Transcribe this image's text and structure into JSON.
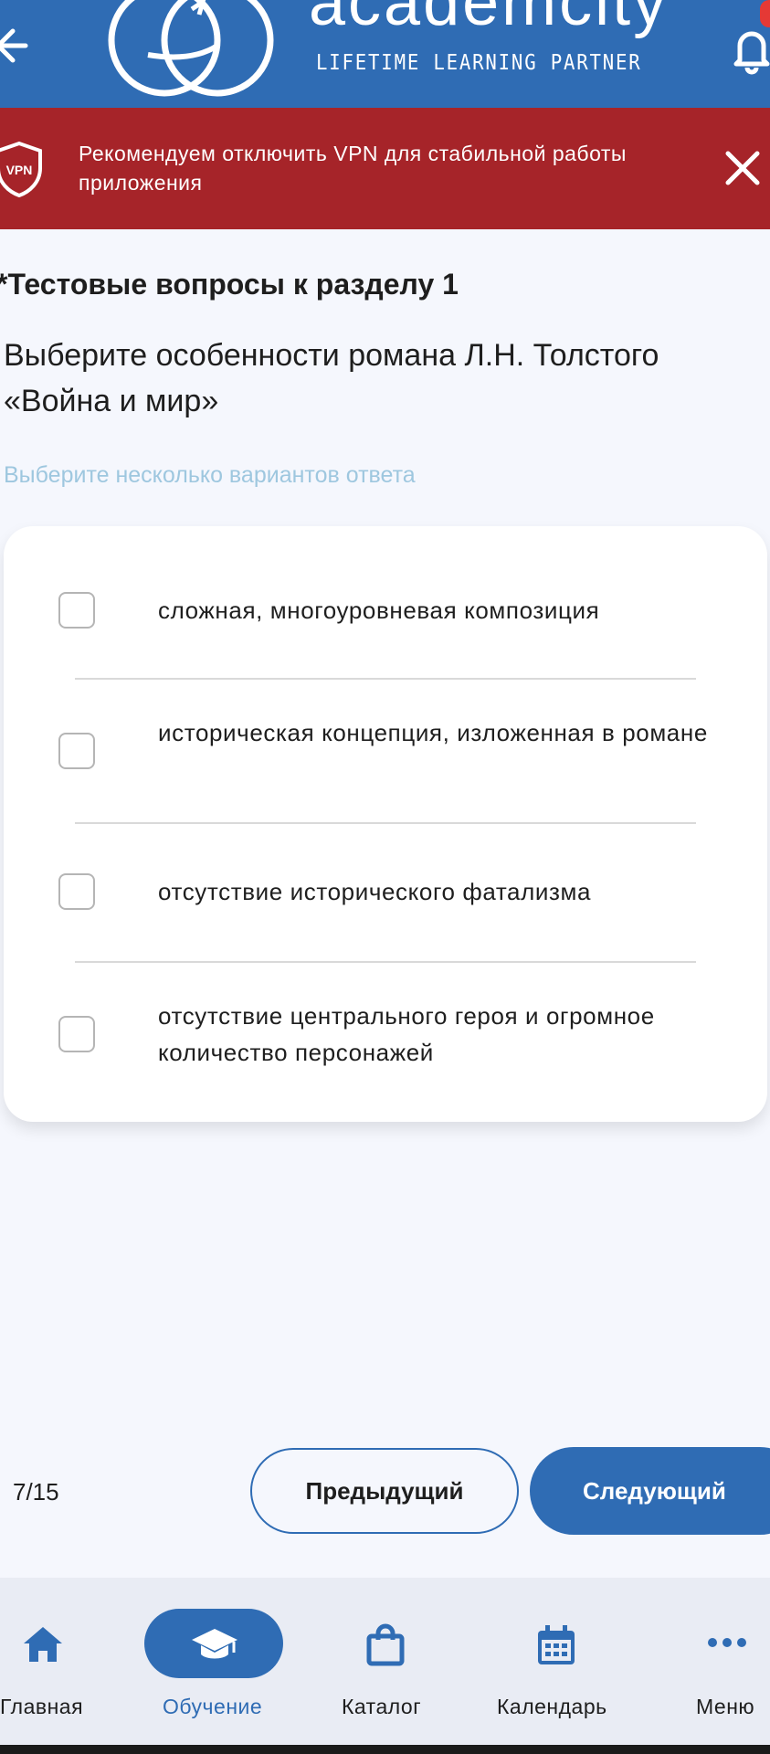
{
  "header": {
    "brand_name": "academcity",
    "tagline": "LIFETIME LEARNING PARTNER"
  },
  "banner": {
    "text": "Рекомендуем отключить VPN для стабильной работы приложения",
    "icon_label": "VPN"
  },
  "test": {
    "section_title": "*Тестовые вопросы к разделу 1",
    "question": "Выберите особенности романа Л.Н. Толстого «Война и мир»",
    "hint": "Выберите несколько вариантов ответа",
    "options": [
      "сложная, многоуровневая композиция",
      "историческая концепция, изложенная в романе",
      "отсутствие исторического фатализма",
      "отсутствие центрального героя и огромное количество персонажей"
    ]
  },
  "pager": {
    "counter": "7/15",
    "prev_label": "Предыдущий",
    "next_label": "Следующий"
  },
  "nav": {
    "items": [
      {
        "label": "Главная",
        "icon": "home-icon"
      },
      {
        "label": "Обучение",
        "icon": "graduation-cap-icon",
        "active": true
      },
      {
        "label": "Каталог",
        "icon": "shopping-bag-icon"
      },
      {
        "label": "Календарь",
        "icon": "calendar-icon"
      },
      {
        "label": "Меню",
        "icon": "more-dots-icon"
      }
    ]
  },
  "colors": {
    "primary": "#2f6cb4",
    "banner": "#a62429",
    "hint": "#9ec7df",
    "background": "#f5f7fd"
  }
}
